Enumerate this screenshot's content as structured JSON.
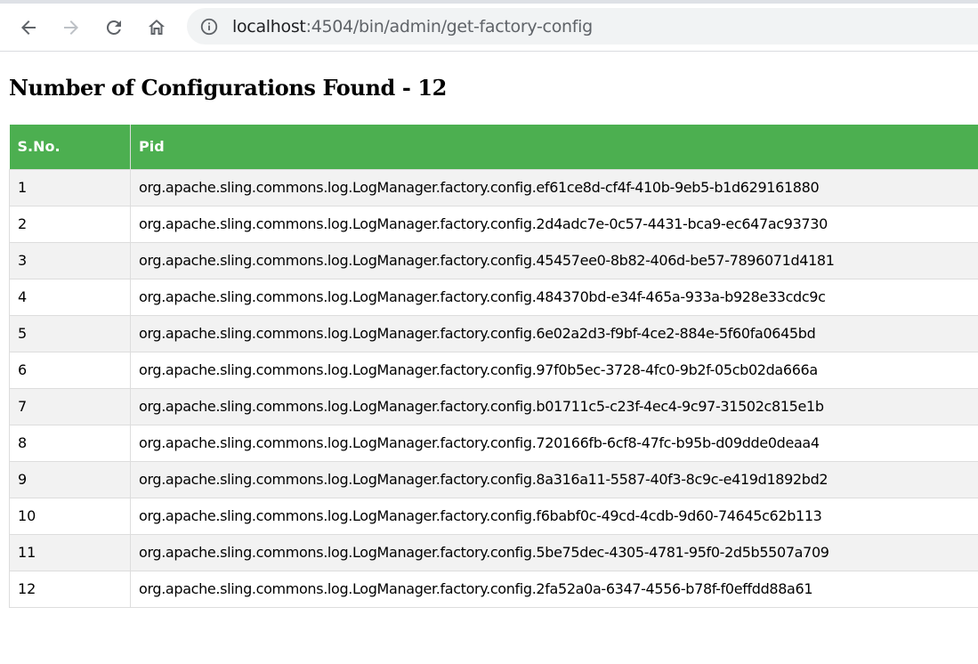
{
  "browser": {
    "url_host": "localhost",
    "url_rest": ":4504/bin/admin/get-factory-config"
  },
  "page": {
    "title": "Number of Configurations Found - 12"
  },
  "table": {
    "headers": [
      "S.No.",
      "Pid"
    ],
    "rows": [
      {
        "sno": "1",
        "pid": "org.apache.sling.commons.log.LogManager.factory.config.ef61ce8d-cf4f-410b-9eb5-b1d629161880"
      },
      {
        "sno": "2",
        "pid": "org.apache.sling.commons.log.LogManager.factory.config.2d4adc7e-0c57-4431-bca9-ec647ac93730"
      },
      {
        "sno": "3",
        "pid": "org.apache.sling.commons.log.LogManager.factory.config.45457ee0-8b82-406d-be57-7896071d4181"
      },
      {
        "sno": "4",
        "pid": "org.apache.sling.commons.log.LogManager.factory.config.484370bd-e34f-465a-933a-b928e33cdc9c"
      },
      {
        "sno": "5",
        "pid": "org.apache.sling.commons.log.LogManager.factory.config.6e02a2d3-f9bf-4ce2-884e-5f60fa0645bd"
      },
      {
        "sno": "6",
        "pid": "org.apache.sling.commons.log.LogManager.factory.config.97f0b5ec-3728-4fc0-9b2f-05cb02da666a"
      },
      {
        "sno": "7",
        "pid": "org.apache.sling.commons.log.LogManager.factory.config.b01711c5-c23f-4ec4-9c97-31502c815e1b"
      },
      {
        "sno": "8",
        "pid": "org.apache.sling.commons.log.LogManager.factory.config.720166fb-6cf8-47fc-b95b-d09dde0deaa4"
      },
      {
        "sno": "9",
        "pid": "org.apache.sling.commons.log.LogManager.factory.config.8a316a11-5587-40f3-8c9c-e419d1892bd2"
      },
      {
        "sno": "10",
        "pid": "org.apache.sling.commons.log.LogManager.factory.config.f6babf0c-49cd-4cdb-9d60-74645c62b113"
      },
      {
        "sno": "11",
        "pid": "org.apache.sling.commons.log.LogManager.factory.config.5be75dec-4305-4781-95f0-2d5b5507a709"
      },
      {
        "sno": "12",
        "pid": "org.apache.sling.commons.log.LogManager.factory.config.2fa52a0a-6347-4556-b78f-f0effdd88a61"
      }
    ]
  },
  "icons": {
    "back": "arrow-left-icon",
    "forward": "arrow-right-icon",
    "reload": "reload-icon",
    "home": "home-icon",
    "site_info": "info-icon"
  },
  "colors": {
    "header_bg": "#4caf50",
    "row_stripe": "#f2f2f2"
  }
}
